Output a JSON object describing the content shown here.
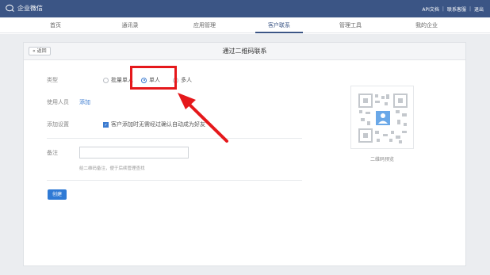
{
  "brand": {
    "name": "企业微信",
    "icon": "chat-bubble-icon"
  },
  "toplinks": [
    "API文档",
    "联系客服",
    "退出"
  ],
  "nav": [
    "首页",
    "通讯录",
    "应用管理",
    "客户联系",
    "管理工具",
    "我的企业"
  ],
  "nav_active": "客户联系",
  "panel": {
    "back": "« 返回",
    "title": "通过二维码联系"
  },
  "form": {
    "type_label": "类型",
    "type_options": [
      "批量单人",
      "单人",
      "多人"
    ],
    "type_selected": "单人",
    "user_label": "使用人员",
    "user_link": "添加",
    "setting_label": "添加设置",
    "setting_text": "客户添加时无需经过确认自动成为好友",
    "note_label": "备注",
    "note_hint": "给二维码备注，便于后续管理查找",
    "create": "创建"
  },
  "qr": {
    "label": "二维码预览",
    "icon": "qr-code-icon"
  },
  "colors": {
    "topbar": "#3b5585",
    "primary": "#2f7ad5",
    "highlight": "#e5181b"
  }
}
